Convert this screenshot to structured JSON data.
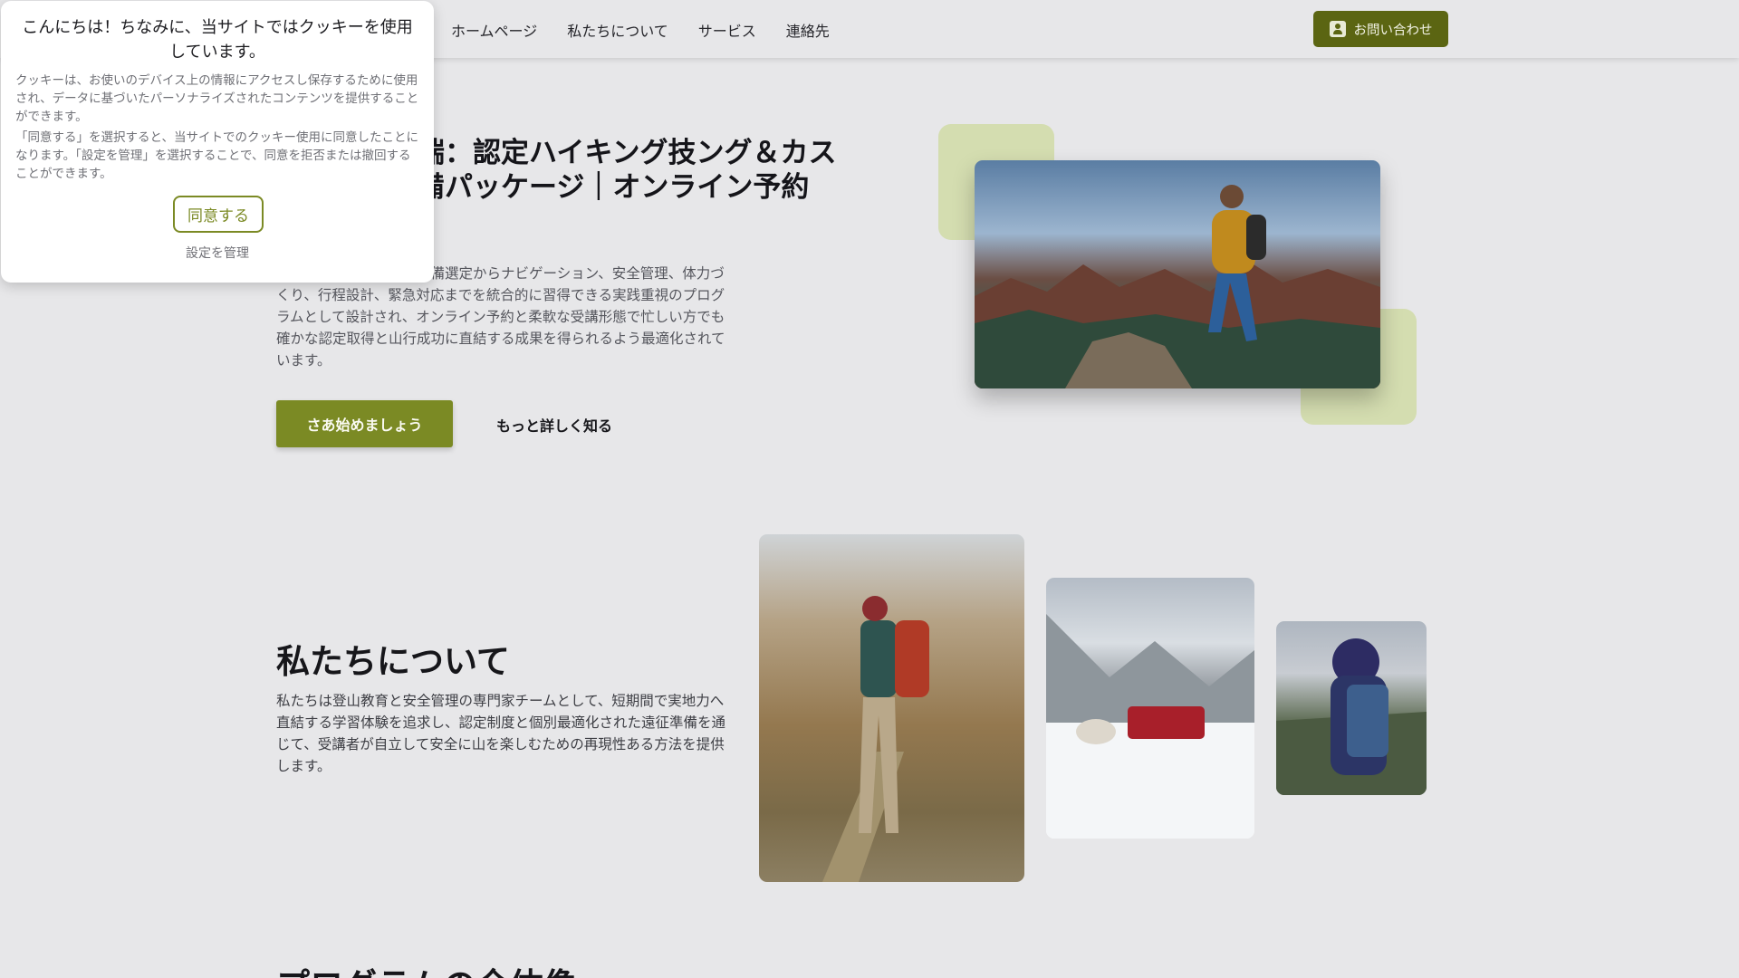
{
  "nav": {
    "items": [
      "ホームページ",
      "私たちについて",
      "サービス",
      "連絡先"
    ],
    "contact_label": "お問い合わせ"
  },
  "hero": {
    "title": "イル準備万端：認定ハイキング技ング＆カスタム遠征準備パッケージ｜オンライン予約",
    "description": "登山技能を体系化し、装備選定からナビゲーション、安全管理、体力づくり、行程設計、緊急対応までを統合的に習得できる実践重視のプログラムとして設計され、オンライン予約と柔軟な受講形態で忙しい方でも確かな認定取得と山行成功に直結する成果を得られるよう最適化されています。",
    "start_button": "さあ始めましょう",
    "more_link": "もっと詳しく知る"
  },
  "about": {
    "title": "私たちについて",
    "description": "私たちは登山教育と安全管理の専門家チームとして、短期間で実地力へ直結する学習体験を追求し、認定制度と個別最適化された遠征準備を通じて、受講者が自立して安全に山を楽しむための再現性ある方法を提供します。"
  },
  "next_section": {
    "title": "プログラムの全体像"
  },
  "cookie": {
    "title": "こんにちは！ちなみに、当サイトではクッキーを使用しています。",
    "paragraph1": "クッキーは、お使いのデバイス上の情報にアクセスし保存するために使用され、データに基づいたパーソナライズされたコンテンツを提供することができます。",
    "paragraph2": "「同意する」を選択すると、当サイトでのクッキー使用に同意したことになります。「設定を管理」を選択することで、同意を拒否または撤回することができます。",
    "agree_button": "同意する",
    "manage_link": "設定を管理"
  },
  "colors": {
    "accent": "#7b8a24",
    "accent_dark": "#5b6512",
    "decor": "#d4ddb0",
    "background": "#e7e7e9"
  }
}
